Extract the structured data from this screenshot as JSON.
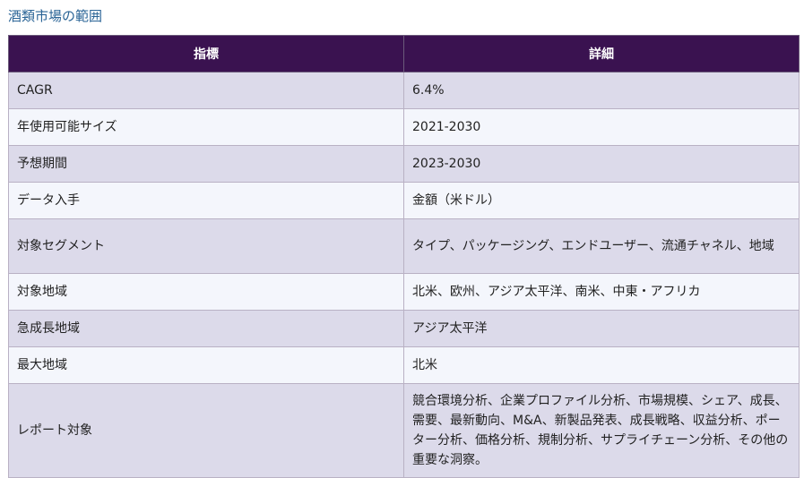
{
  "section": {
    "title": "酒類市場の範囲"
  },
  "table": {
    "headers": [
      "指標",
      "詳細"
    ],
    "rows": [
      {
        "metric": "CAGR",
        "detail": "6.4%"
      },
      {
        "metric": "年使用可能サイズ",
        "detail": "2021-2030"
      },
      {
        "metric": "予想期間",
        "detail": "2023-2030"
      },
      {
        "metric": "データ入手",
        "detail": "金額（米ドル）"
      },
      {
        "metric": "対象セグメント",
        "detail": "タイプ、パッケージング、エンドユーザー、流通チャネル、地域"
      },
      {
        "metric": "対象地域",
        "detail": "北米、欧州、アジア太平洋、南米、中東・アフリカ"
      },
      {
        "metric": "急成長地域",
        "detail": "アジア太平洋"
      },
      {
        "metric": "最大地域",
        "detail": "北米"
      },
      {
        "metric": "レポート対象",
        "detail": "競合環境分析、企業プロファイル分析、市場規模、シェア、成長、需要、最新動向、M&A、新製品発表、成長戦略、収益分析、ポーター分析、価格分析、規制分析、サプライチェーン分析、その他の重要な洞察。"
      }
    ]
  },
  "colors": {
    "header_bg": "#3a1250",
    "row_odd_bg": "#dcdaea",
    "row_even_bg": "#f4f6fc",
    "title_text": "#2a6496"
  }
}
